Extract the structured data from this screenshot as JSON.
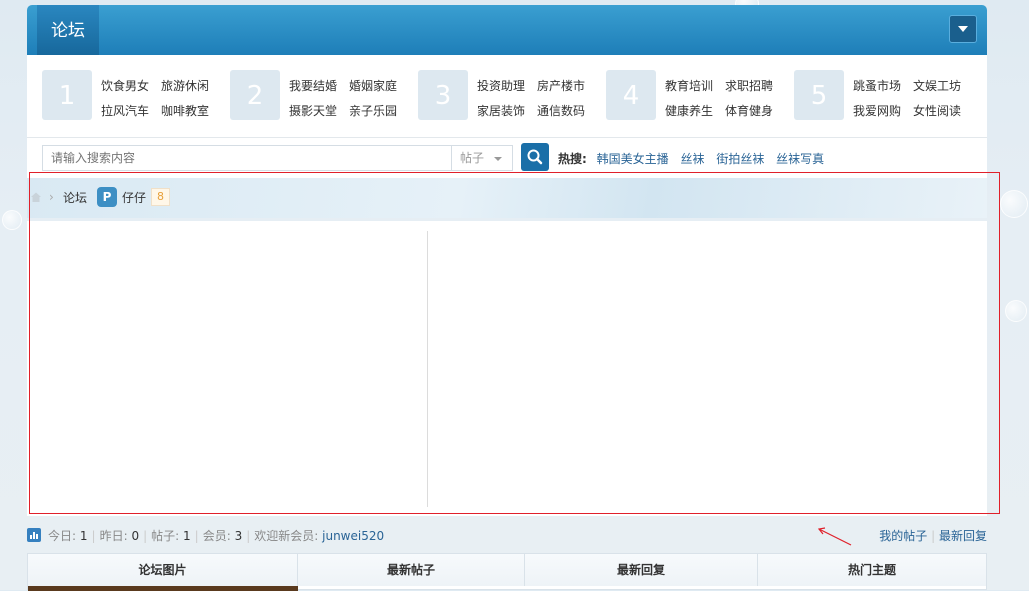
{
  "header": {
    "tab_title": "论坛"
  },
  "categories": [
    {
      "num": "1",
      "links": [
        "饮食男女",
        "旅游休闲",
        "拉风汽车",
        "咖啡教室"
      ]
    },
    {
      "num": "2",
      "links": [
        "我要结婚",
        "婚姻家庭",
        "摄影天堂",
        "亲子乐园"
      ]
    },
    {
      "num": "3",
      "links": [
        "投资助理",
        "房产楼市",
        "家居装饰",
        "通信数码"
      ]
    },
    {
      "num": "4",
      "links": [
        "教育培训",
        "求职招聘",
        "健康养生",
        "体育健身"
      ]
    },
    {
      "num": "5",
      "links": [
        "跳蚤市场",
        "文娱工坊",
        "我爱网购",
        "女性阅读"
      ]
    }
  ],
  "search": {
    "placeholder": "请输入搜索内容",
    "type_selected": "帖子",
    "hot_label": "热搜:",
    "hot_links": [
      "韩国美女主播",
      "丝袜",
      "街拍丝袜",
      "丝袜写真"
    ]
  },
  "breadcrumb": {
    "forum": "论坛",
    "zone_icon_letter": "P",
    "zone": "仔仔",
    "count": "8"
  },
  "stats": {
    "today_label": "今日:",
    "today": "1",
    "yesterday_label": "昨日:",
    "yesterday": "0",
    "posts_label": "帖子:",
    "posts": "1",
    "members_label": "会员:",
    "members": "3",
    "welcome_label": "欢迎新会员:",
    "new_member": "junwei520",
    "my_posts": "我的帖子",
    "latest_replies": "最新回复"
  },
  "table": {
    "headers": [
      "论坛图片",
      "最新帖子",
      "最新回复",
      "热门主题"
    ]
  },
  "colors": {
    "header_blue": "#1e7eb8",
    "link_blue": "#2a6496",
    "annotation_red": "#e0202a"
  }
}
